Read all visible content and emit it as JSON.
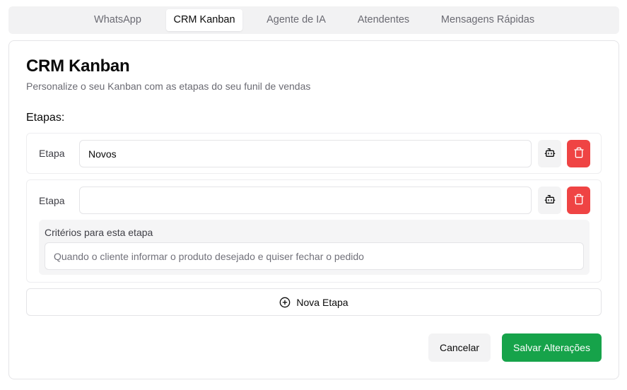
{
  "tabs": [
    {
      "label": "WhatsApp",
      "active": false
    },
    {
      "label": "CRM Kanban",
      "active": true
    },
    {
      "label": "Agente de IA",
      "active": false
    },
    {
      "label": "Atendentes",
      "active": false
    },
    {
      "label": "Mensagens Rápidas",
      "active": false
    }
  ],
  "page": {
    "title": "CRM Kanban",
    "subtitle": "Personalize o seu Kanban com as etapas do seu funil de vendas",
    "section_label": "Etapas:"
  },
  "stages": [
    {
      "label": "Etapa",
      "value": "Novos",
      "has_criteria": false
    },
    {
      "label": "Etapa",
      "value": "",
      "has_criteria": true,
      "criteria_label": "Critérios para esta etapa",
      "criteria_placeholder": "Quando o cliente informar o produto desejado e quiser fechar o pedido"
    }
  ],
  "actions": {
    "new_stage_label": "Nova Etapa",
    "cancel_label": "Cancelar",
    "save_label": "Salvar Alterações"
  },
  "colors": {
    "delete": "#ef4444",
    "save": "#16a34a",
    "tab_bar": "#f2f2f3"
  },
  "icons": {
    "stage_ai": "robot-icon",
    "stage_delete": "trash-icon",
    "new_stage": "plus-circle-icon"
  }
}
